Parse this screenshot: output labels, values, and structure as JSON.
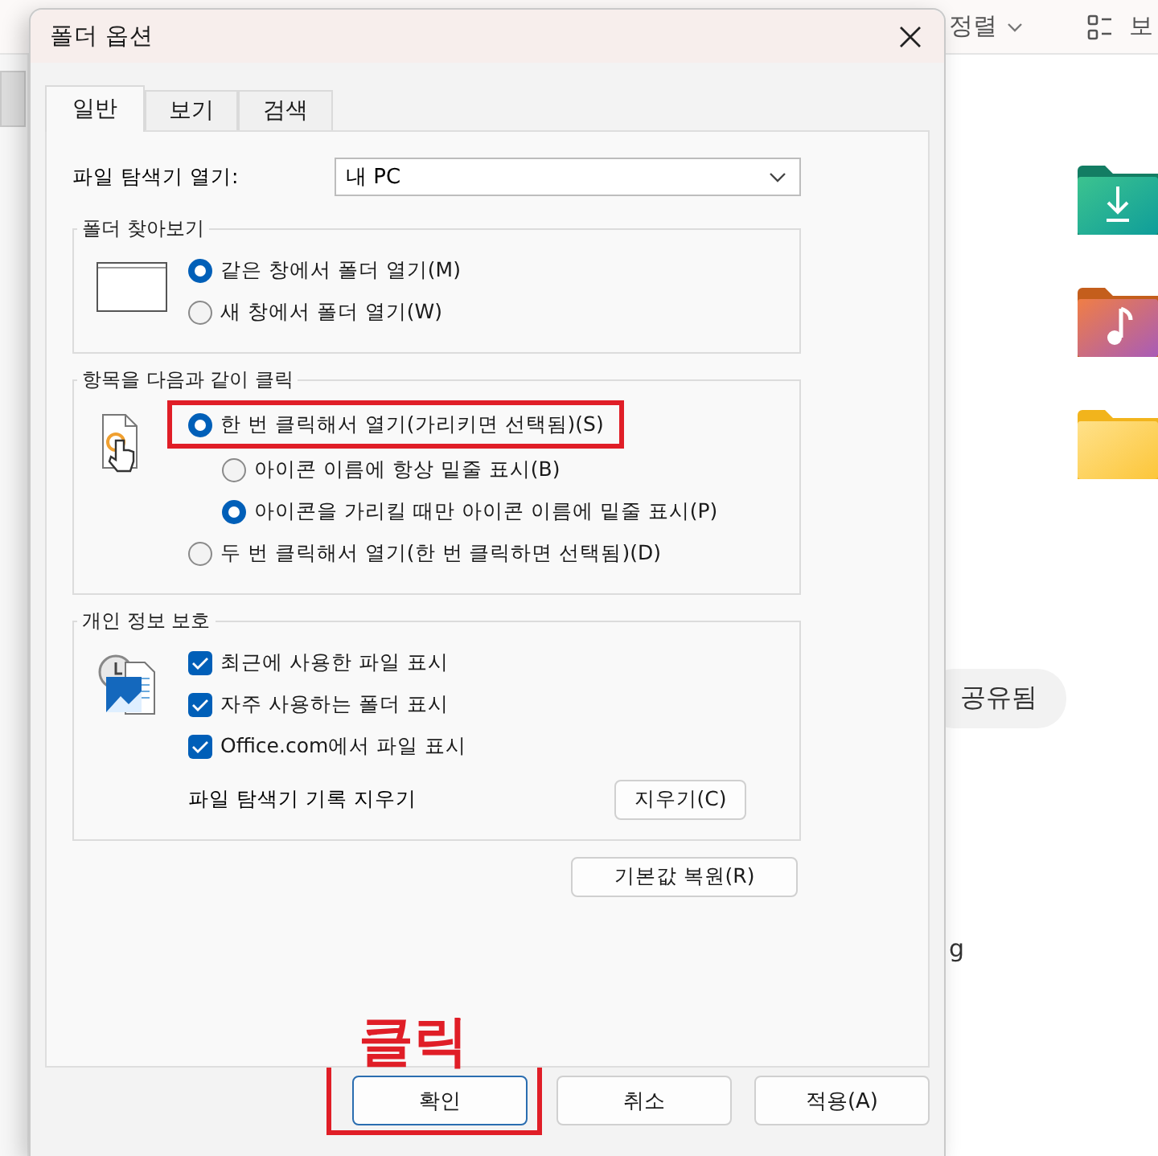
{
  "explorer": {
    "toolbar": [
      {
        "kind": "sort",
        "label": "정렬"
      },
      {
        "kind": "view",
        "label": "보"
      }
    ],
    "folders": [
      {
        "kind": "download"
      },
      {
        "kind": "music"
      },
      {
        "kind": "plain"
      }
    ],
    "chip": "공유됨",
    "partial_text": "g"
  },
  "dialog": {
    "title": "폴더 옵션",
    "tabs": [
      {
        "label": "일반",
        "selected": true
      },
      {
        "label": "보기",
        "selected": false
      },
      {
        "label": "검색",
        "selected": false
      }
    ],
    "open_explorer": {
      "label": "파일 탐색기 열기:",
      "value": "내 PC"
    },
    "groups": [
      {
        "title": "폴더 찾아보기",
        "options": [
          {
            "kind": "radio",
            "label": "같은 창에서 폴더 열기(M)",
            "selected": true,
            "highlighted": false
          },
          {
            "kind": "radio",
            "label": "새 창에서 폴더 열기(W)",
            "selected": false,
            "highlighted": false
          }
        ]
      },
      {
        "title": "항목을 다음과 같이 클릭",
        "options": [
          {
            "kind": "radio",
            "label": "한 번 클릭해서 열기(가리키면 선택됨)(S)",
            "selected": true,
            "highlighted": true,
            "children": [
              {
                "kind": "radio",
                "label": "아이콘 이름에 항상 밑줄 표시(B)",
                "selected": false,
                "highlighted": false
              },
              {
                "kind": "radio",
                "label": "아이콘을 가리킬 때만 아이콘 이름에 밑줄 표시(P)",
                "selected": true,
                "highlighted": false
              }
            ]
          },
          {
            "kind": "radio",
            "label": "두 번 클릭해서 열기(한 번 클릭하면 선택됨)(D)",
            "selected": false,
            "highlighted": false
          }
        ]
      },
      {
        "title": "개인 정보 보호",
        "options": [
          {
            "kind": "checkbox",
            "label": "최근에 사용한 파일 표시",
            "checked": true
          },
          {
            "kind": "checkbox",
            "label": "자주 사용하는 폴더 표시",
            "checked": true
          },
          {
            "kind": "checkbox",
            "label": "Office.com에서 파일 표시",
            "checked": true
          }
        ],
        "clear": {
          "label": "파일 탐색기 기록 지우기",
          "button": "지우기(C)"
        }
      }
    ],
    "restore_button": "기본값 복원(R)",
    "buttons": [
      {
        "label": "확인",
        "highlighted": true
      },
      {
        "label": "취소",
        "highlighted": false
      },
      {
        "label": "적용(A)",
        "highlighted": false
      }
    ],
    "annotation": "클릭"
  }
}
